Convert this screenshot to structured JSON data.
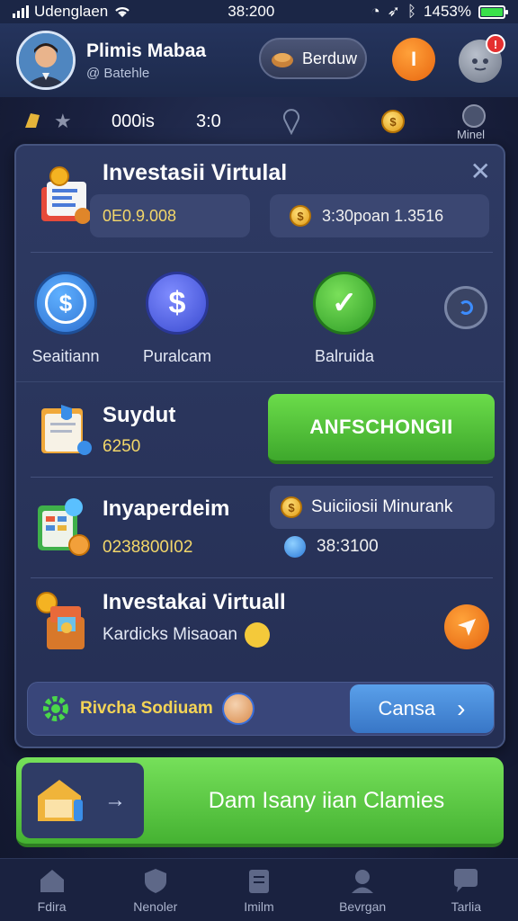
{
  "status_bar": {
    "carrier": "Udenglaen",
    "time": "38:200",
    "battery": "1453%"
  },
  "header": {
    "profile_name": "Plimis Mabaa",
    "profile_handle": "@ Batehle",
    "pill_button": "Berduw",
    "orange_button": "I",
    "notification_badge": "!"
  },
  "sub_bar": {
    "label": "000is",
    "value": "3:0",
    "right_label": "Minel"
  },
  "panel": {
    "title": "Investasii Virtulal",
    "close": "✕",
    "balance_left": "0E0.9.008",
    "balance_right": "3:30poan 1.3516",
    "actions": [
      {
        "label": "Seaitiann",
        "icon": "$"
      },
      {
        "label": "Puralcam",
        "icon": "$"
      },
      {
        "label": "Balruida",
        "icon": "✓"
      }
    ],
    "row1": {
      "title": "Suydut",
      "value": "6250",
      "button": "ANFSCHONGII"
    },
    "row2": {
      "title": "Inyaperdeim",
      "value": "0238800I02",
      "chip_label": "Suiciiosii Minurank",
      "chip_value": "38:3100"
    },
    "row3": {
      "title": "Investakai Virtuall",
      "subtitle": "Kardicks Misaoan"
    },
    "strip": {
      "label": "Rivcha Sodiuam",
      "button": "Cansa",
      "arrow": "›"
    }
  },
  "claim": {
    "label": "Dam Isany iian Clamies",
    "arrow": "→"
  },
  "bottom_nav": [
    {
      "label": "Fdira",
      "icon": "home-icon"
    },
    {
      "label": "Nenoler",
      "icon": "shield-icon"
    },
    {
      "label": "Imilm",
      "icon": "clipboard-icon"
    },
    {
      "label": "Bevrgan",
      "icon": "user-icon"
    },
    {
      "label": "Tarlia",
      "icon": "chat-icon"
    }
  ],
  "colors": {
    "accent_green": "#5cc83c",
    "accent_orange": "#f07a18",
    "accent_blue": "#4a8ad8",
    "panel_bg": "#2a3560",
    "value_yellow": "#f3d76a"
  }
}
